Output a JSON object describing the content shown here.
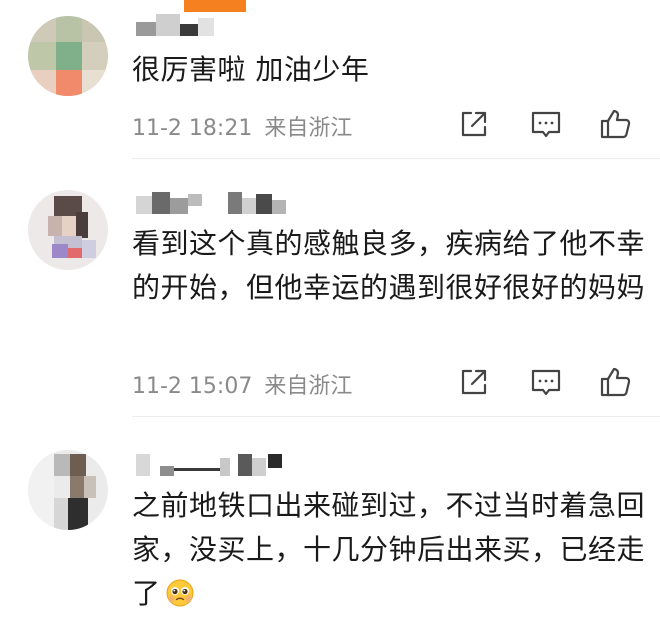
{
  "comments": [
    {
      "text": "很厉害啦 加油少年",
      "time": "11-2 18:21",
      "location": "来自浙江"
    },
    {
      "text": "看到这个真的感触良多，疾病给了他不幸的开始，但他幸运的遇到很好很好的妈妈",
      "time": "11-2 15:07",
      "location": "来自浙江"
    },
    {
      "text": "之前地铁口出来碰到过，不过当时着急回家，没买上，十几分钟后出来买，已经走了"
    }
  ],
  "icons": {
    "share": "share-icon",
    "comment": "comment-icon",
    "like": "like-icon",
    "emoji": "pleading-face-emoji"
  },
  "colors": {
    "meta_text": "#8a8a8a",
    "icon_stroke": "#444444",
    "accent_tab": "#f5801f"
  }
}
